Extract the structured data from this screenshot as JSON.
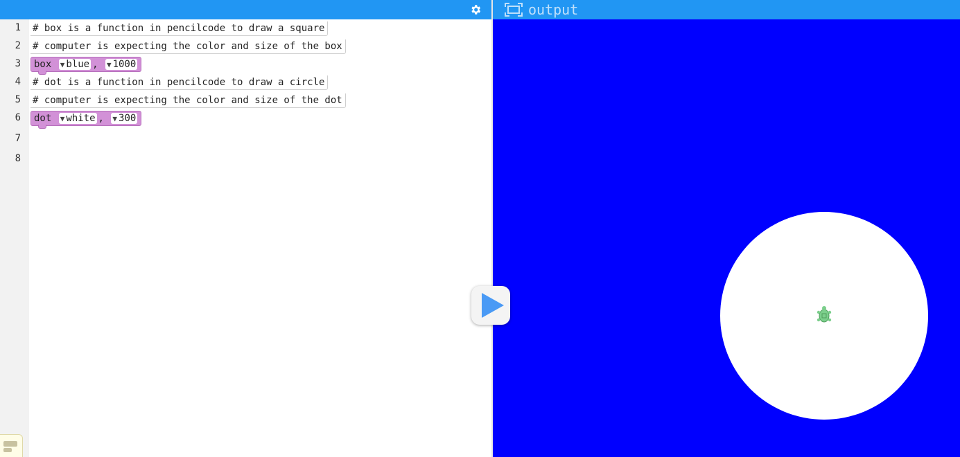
{
  "editor": {
    "line_numbers": [
      "1",
      "2",
      "3",
      "4",
      "5",
      "6",
      "7",
      "8"
    ],
    "lines": {
      "l1": "# box is a function in pencilcode to draw a square",
      "l2": "# computer is expecting the color and size of the box",
      "l3": {
        "keyword": "box",
        "color": "blue",
        "comma": ",",
        "size": "1000"
      },
      "l4": "# dot is a function in pencilcode to draw a circle",
      "l5": "# computer is expecting the color and size of the dot",
      "l6": {
        "keyword": "dot",
        "color": "white",
        "comma": ",",
        "size": "300"
      }
    },
    "block_color": "#d291d7",
    "header_color": "#2196f3"
  },
  "output": {
    "title": "output",
    "background_color": "#0000ff",
    "dot_color": "#ffffff",
    "turtle_color": "#7ccf8c"
  },
  "icons": {
    "settings": "gear-icon",
    "run": "play-icon",
    "output": "screen-icon",
    "palette": "blocks-icon"
  }
}
